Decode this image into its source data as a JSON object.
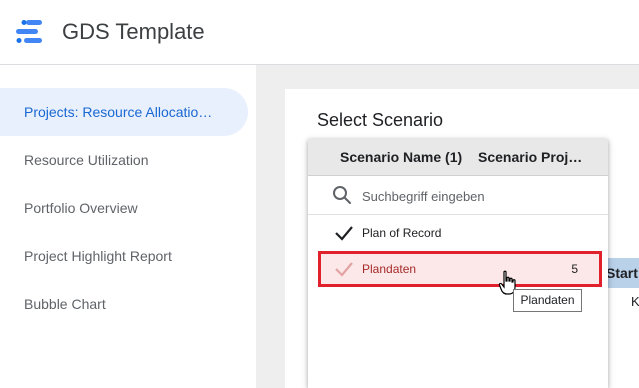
{
  "header": {
    "app_title": "GDS Template",
    "logo_icon": "data-studio-logo-icon"
  },
  "sidebar": {
    "items": [
      {
        "label": "Projects: Resource Allocatio…",
        "active": true
      },
      {
        "label": "Resource Utilization",
        "active": false
      },
      {
        "label": "Portfolio Overview",
        "active": false
      },
      {
        "label": "Project Highlight Report",
        "active": false
      },
      {
        "label": "Bubble Chart",
        "active": false
      }
    ]
  },
  "main": {
    "select_title": "Select Scenario",
    "background_table": {
      "header_cell": "Start",
      "cell": "K"
    }
  },
  "dropdown": {
    "columns": [
      "Scenario Name (1)",
      "Scenario Proje…"
    ],
    "search": {
      "placeholder": "Suchbegriff eingeben",
      "value": "",
      "icon": "search-icon"
    },
    "options": [
      {
        "label": "Plan of Record",
        "count": "",
        "checked": true
      },
      {
        "label": "Plandaten",
        "count": "5",
        "checked": false
      }
    ]
  },
  "tooltip": {
    "text": "Plandaten"
  },
  "colors": {
    "accent": "#1967d2",
    "active_nav_bg": "#e8f0fe",
    "highlight_border": "#e0202a",
    "highlight_bg": "#fce8e8"
  }
}
